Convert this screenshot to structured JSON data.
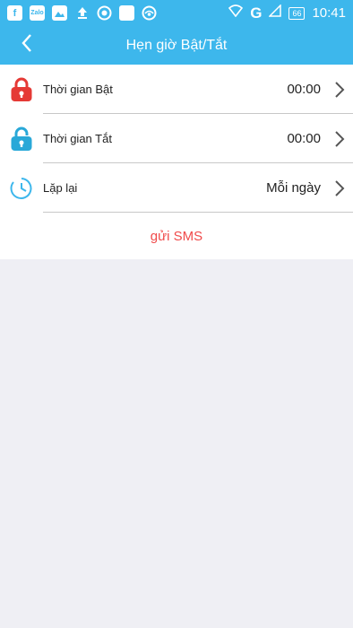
{
  "status_bar": {
    "left_icons": [
      "facebook-icon",
      "zalo-icon",
      "gallery-icon",
      "upload-icon",
      "sync-icon",
      "notification-icon",
      "eye-icon"
    ],
    "zalo_text": "Zalo",
    "network": "G",
    "battery": "66",
    "time": "10:41"
  },
  "header": {
    "title": "Hẹn giờ Bật/Tắt",
    "back_icon": "chevron-left-icon"
  },
  "rows": [
    {
      "label": "Thời gian Bật",
      "value": "00:00",
      "icon": "lock-closed-icon",
      "color": "#e53935"
    },
    {
      "label": "Thời gian Tắt",
      "value": "00:00",
      "icon": "lock-open-icon",
      "color": "#29a8d8"
    },
    {
      "label": "Lặp lại",
      "value": "Mỗi ngày",
      "icon": "clock-icon",
      "color": "#3db7ec"
    }
  ],
  "send_label": "gửi SMS",
  "colors": {
    "accent": "#3db7ec",
    "send": "#f04a4a",
    "background": "#efeff4"
  }
}
